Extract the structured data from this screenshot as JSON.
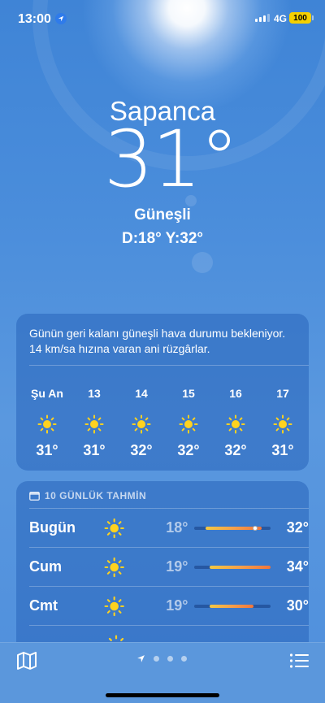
{
  "status_bar": {
    "time": "13:00",
    "network": "4G",
    "battery": "100"
  },
  "weather": {
    "city": "Sapanca",
    "temperature": "31°",
    "condition": "Güneşli",
    "hi_lo": "D:18°  Y:32°"
  },
  "hourly": {
    "summary": "Günün geri kalanı güneşli hava durumu bekleniyor. 14 km/sa hızına varan ani rüzgârlar.",
    "items": [
      {
        "label": "Şu An",
        "icon": "sun-icon",
        "temp": "31°"
      },
      {
        "label": "13",
        "icon": "sun-icon",
        "temp": "31°"
      },
      {
        "label": "14",
        "icon": "sun-icon",
        "temp": "32°"
      },
      {
        "label": "15",
        "icon": "sun-icon",
        "temp": "32°"
      },
      {
        "label": "16",
        "icon": "sun-icon",
        "temp": "32°"
      },
      {
        "label": "17",
        "icon": "sun-icon",
        "temp": "31°"
      }
    ]
  },
  "daily": {
    "header": "10 GÜNLÜK TAHMİN",
    "days": [
      {
        "day": "Bugün",
        "icon": "sun-icon",
        "low": "18°",
        "high": "32°",
        "range_start": 0.14,
        "range_end": 0.88,
        "current": 0.8
      },
      {
        "day": "Cum",
        "icon": "sun-icon",
        "low": "19°",
        "high": "34°",
        "range_start": 0.2,
        "range_end": 1.0
      },
      {
        "day": "Cmt",
        "icon": "sun-icon",
        "low": "19°",
        "high": "30°",
        "range_start": 0.2,
        "range_end": 0.78
      }
    ]
  },
  "colors": {
    "battery": "#f5d000",
    "sun": "#ffd21f",
    "location": "#2f7bea"
  }
}
